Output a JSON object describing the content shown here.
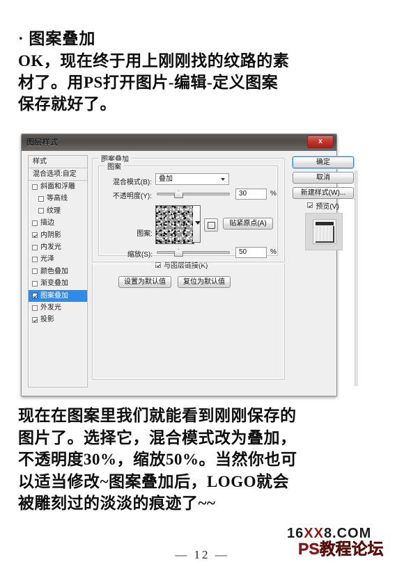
{
  "article": {
    "heading": "· 图案叠加",
    "paragraph_top_lines": [
      "OK，现在终于用上刚刚找的纹路的素",
      "材了。用PS打开图片-编辑-定义图案",
      "保存就好了。"
    ],
    "paragraph_bottom_lines": [
      "现在在图案里我们就能看到刚刚保存的",
      "图片了。选择它，混合模式改为叠加，",
      "不透明度30%，缩放50%。当然你也可",
      "以适当修改~图案叠加后，LOGO就会",
      "被雕刻过的淡淡的痕迹了~~"
    ]
  },
  "footer": {
    "page_number": "— 12 —",
    "watermark_line1_prefix": "16",
    "watermark_line1_mid": "XX",
    "watermark_line1_suffix": "8.COM",
    "watermark_line2": "PS教程论坛"
  },
  "dialog": {
    "title": "图层样式",
    "close_label": "x",
    "styles_panel": {
      "header": "样式",
      "blending_options": "混合选项:自定",
      "items": [
        {
          "label": "斜面和浮雕",
          "checked": false,
          "indent": false,
          "selected": false
        },
        {
          "label": "等高线",
          "checked": false,
          "indent": true,
          "selected": false
        },
        {
          "label": "纹理",
          "checked": false,
          "indent": true,
          "selected": false
        },
        {
          "label": "描边",
          "checked": false,
          "indent": false,
          "selected": false
        },
        {
          "label": "内阴影",
          "checked": true,
          "indent": false,
          "selected": false
        },
        {
          "label": "内发光",
          "checked": false,
          "indent": false,
          "selected": false
        },
        {
          "label": "光泽",
          "checked": false,
          "indent": false,
          "selected": false
        },
        {
          "label": "颜色叠加",
          "checked": false,
          "indent": false,
          "selected": false
        },
        {
          "label": "渐变叠加",
          "checked": false,
          "indent": false,
          "selected": false
        },
        {
          "label": "图案叠加",
          "checked": true,
          "indent": false,
          "selected": true
        },
        {
          "label": "外发光",
          "checked": false,
          "indent": false,
          "selected": false
        },
        {
          "label": "投影",
          "checked": true,
          "indent": false,
          "selected": false
        }
      ]
    },
    "group_outer_title": "图案叠加",
    "group_inner_title": "图案",
    "fields": {
      "blend_mode_label": "混合模式(B):",
      "blend_mode_value": "叠加",
      "opacity_label": "不透明度(Y):",
      "opacity_value": "30",
      "opacity_unit": "%",
      "pattern_label": "图案:",
      "snap_origin_label": "贴紧原点(A)",
      "scale_label": "缩放(S):",
      "scale_value": "50",
      "scale_unit": "%",
      "link_layer_label": "与图层链接(K)",
      "link_layer_checked": true
    },
    "default_buttons": {
      "set_default": "设置为默认值",
      "reset_default": "复位为默认值"
    },
    "right_buttons": {
      "ok": "确定",
      "cancel": "取消",
      "new_style": "新建样式(W)...",
      "preview_label": "预览(V)",
      "preview_checked": true
    }
  },
  "colors": {
    "selection_blue": "#2e8bea",
    "dialog_bg": "#efefef",
    "titlebar": "#4e4b49",
    "close_red": "#c1332c",
    "watermark_red": "#8f1713"
  }
}
